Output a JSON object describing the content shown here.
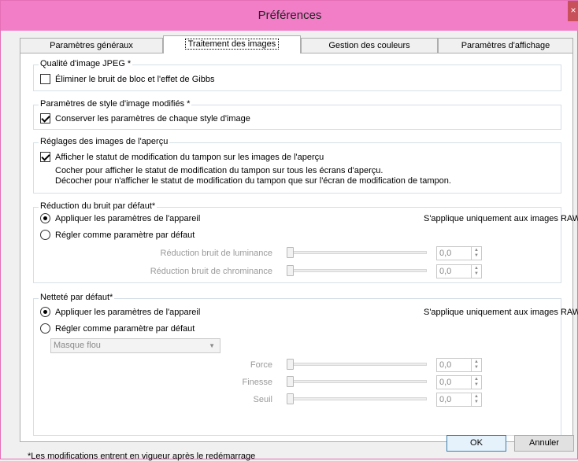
{
  "window": {
    "title": "Préférences",
    "close_glyph": "×"
  },
  "tabs": [
    {
      "label": "Paramètres généraux"
    },
    {
      "label": "Traitement des images"
    },
    {
      "label": "Gestion des couleurs"
    },
    {
      "label": "Paramètres d'affichage"
    }
  ],
  "jpeg": {
    "group_label": "Qualité d'image JPEG *",
    "option": "Éliminer le bruit de bloc et l'effet de Gibbs",
    "checked": false
  },
  "style": {
    "group_label": "Paramètres de style d'image modifiés *",
    "option": "Conserver les paramètres de chaque style d'image",
    "checked": true
  },
  "preview": {
    "group_label": "Réglages des images de l'aperçu",
    "option": "Afficher le statut de modification du tampon sur les images de l'aperçu",
    "checked": true,
    "note_line1": "Cocher pour afficher le statut de modification du tampon sur tous les écrans d'aperçu.",
    "note_line2": "Décocher pour n'afficher le statut de modification du tampon que sur l'écran de modification de tampon."
  },
  "noise": {
    "group_label": "Réduction du bruit par défaut*",
    "radio_device": "Appliquer les paramètres de l'appareil",
    "radio_default": "Régler comme paramètre par défaut",
    "raw_note": "S'applique uniquement aux images RAW",
    "sliders": [
      {
        "label": "Réduction bruit de luminance",
        "value": "0,0"
      },
      {
        "label": "Réduction bruit de chrominance",
        "value": "0,0"
      }
    ]
  },
  "sharpness": {
    "group_label": "Netteté par défaut*",
    "radio_device": "Appliquer les paramètres de l'appareil",
    "radio_default": "Régler comme paramètre par défaut",
    "raw_note": "S'applique uniquement aux images RAW",
    "dropdown": "Masque flou",
    "sliders": [
      {
        "label": "Force",
        "value": "0,0"
      },
      {
        "label": "Finesse",
        "value": "0,0"
      },
      {
        "label": "Seuil",
        "value": "0,0"
      }
    ]
  },
  "footer": {
    "footnote": "*Les modifications entrent en vigueur après le redémarrage",
    "ok": "OK",
    "cancel": "Annuler"
  },
  "colors": {
    "titlebar": "#f27ec8",
    "close": "#c7505b"
  }
}
